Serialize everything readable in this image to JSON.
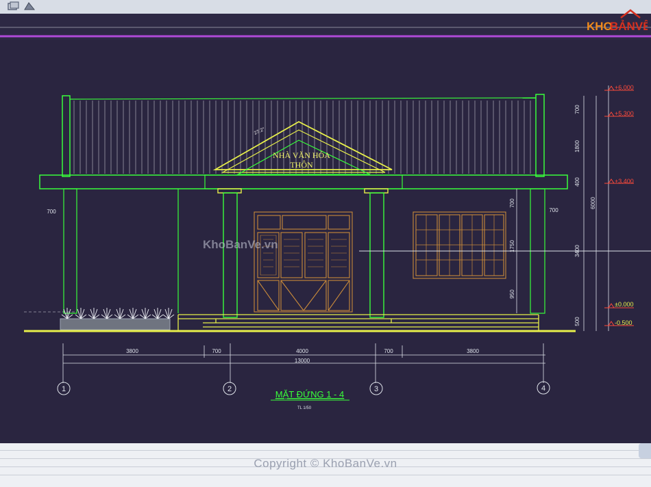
{
  "logo": {
    "text_kho": "KHO",
    "text_banve": "BẢNVẼ",
    "colors": {
      "orange": "#ef8a1c",
      "red": "#d6301f"
    }
  },
  "watermark_center": "KhoBanVe.vn",
  "watermark_bottom": "Copyright © KhoBanVe.vn",
  "drawing": {
    "title": "MẶT ĐỨNG 1 - 4",
    "scale": "TL 1/50",
    "gable_text_line1": "NHÀ VĂN HÓA",
    "gable_text_line2": "THÔN",
    "roof_slope_label": "27.2°",
    "levels": [
      "+6.000",
      "+5.300",
      "+3.400",
      "±0.000",
      "-0.500"
    ],
    "right_vertical_dims": [
      "700",
      "1800",
      "400"
    ],
    "right_overall_dims": [
      "6000",
      "3400",
      "500"
    ],
    "window_dims": [
      "700",
      "1750",
      "950"
    ],
    "side_dims": {
      "left": "700",
      "right": "700"
    },
    "bottom_dims": [
      "3800",
      "700",
      "4000",
      "700",
      "3800"
    ],
    "total_dim": "13000",
    "grid_axes": [
      "1",
      "2",
      "3",
      "4"
    ]
  },
  "colors": {
    "background": "#2a2540",
    "outline": "#39ff3a",
    "accent_yellow": "#e8f04a",
    "door_brown": "#c98a3a",
    "dim_white": "#dfe3ea",
    "level_red": "#ff4a3a",
    "magenta_line": "#b04ad8"
  }
}
